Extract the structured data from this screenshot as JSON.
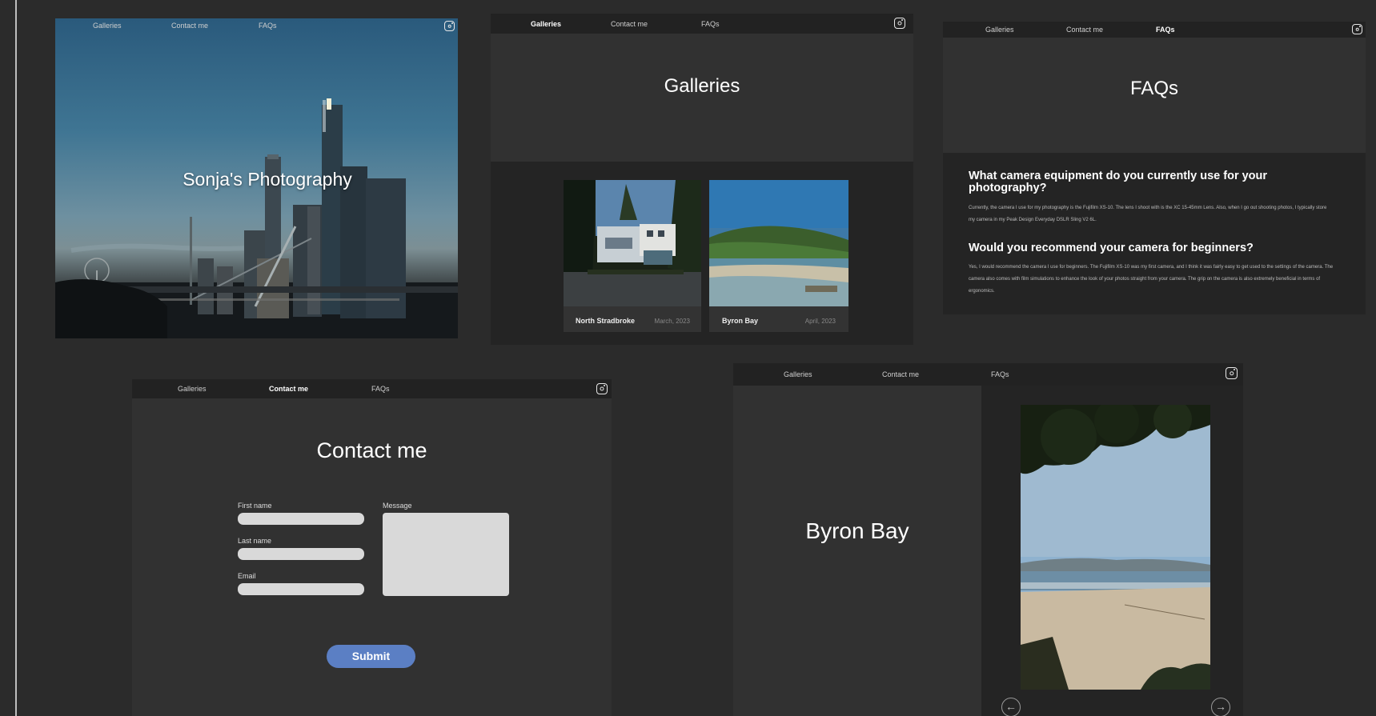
{
  "nav": {
    "galleries": "Galleries",
    "contact": "Contact me",
    "faqs": "FAQs"
  },
  "home": {
    "hero_title": "Sonja's Photography"
  },
  "galleries": {
    "heading": "Galleries",
    "cards": [
      {
        "title": "North Stradbroke",
        "date": "March, 2023"
      },
      {
        "title": "Byron Bay",
        "date": "April, 2023"
      }
    ]
  },
  "faqs": {
    "heading": "FAQs",
    "items": [
      {
        "question": "What camera equipment do you currently use for your photography?",
        "answer": "Currently, the camera I use for my photography is the Fujifilm XS-10. The lens I shoot with is the XC 15-45mm Lens. Also, when I go out shooting photos, I typically store my camera in my Peak Design Everyday DSLR Sling V2 6L."
      },
      {
        "question": "Would you recommend your camera for beginners?",
        "answer": "Yes, I would recommend the camera I use for beginners. The Fujifilm XS-10 was my first camera, and I think it was fairly easy to get used to the settings of the camera. The camera also comes with film simulations to enhance the look of your photos straight from your camera. The grip on the camera is also extremely beneficial in terms of ergonomics."
      }
    ]
  },
  "contact": {
    "heading": "Contact me",
    "first_name": "First name",
    "last_name": "Last name",
    "email": "Email",
    "message": "Message",
    "submit": "Submit"
  },
  "byron": {
    "heading": "Byron Bay",
    "prev": "←",
    "next": "→"
  },
  "colors": {
    "accent": "#5b7fc4",
    "page_bg": "#2b2b2b",
    "nav_bg": "#222222",
    "panel_bg": "#313131"
  }
}
